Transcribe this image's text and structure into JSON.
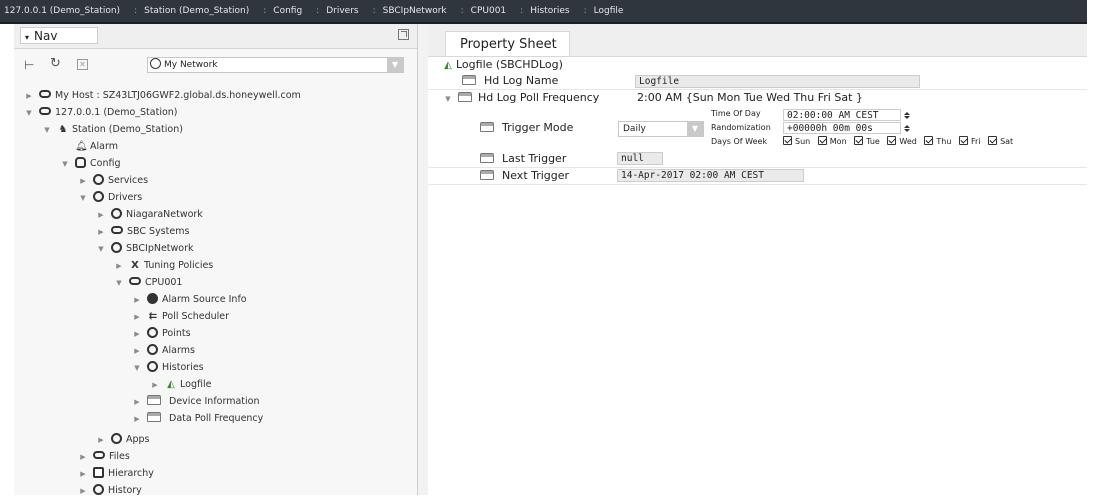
{
  "breadcrumb": [
    "127.0.0.1 (Demo_Station)",
    "Station (Demo_Station)",
    "Config",
    "Drivers",
    "SBCIpNetwork",
    "CPU001",
    "Histories",
    "Logfile"
  ],
  "nav": {
    "title": "Nav",
    "network_dropdown": "My Network",
    "tree": [
      {
        "label": "My Host : SZ43LTJ06GWF2.global.ds.honeywell.com",
        "icon": "host-icon",
        "expanded": false
      },
      {
        "label": "127.0.0.1 (Demo_Station)",
        "icon": "station-connection-icon",
        "expanded": true
      },
      {
        "label": "Station (Demo_Station)",
        "icon": "station-icon",
        "expanded": true
      },
      {
        "label": "Alarm",
        "icon": "bell-icon"
      },
      {
        "label": "Config",
        "icon": "config-icon",
        "expanded": true
      },
      {
        "label": "Services",
        "icon": "services-icon",
        "expanded": false
      },
      {
        "label": "Drivers",
        "icon": "drivers-icon",
        "expanded": true
      },
      {
        "label": "NiagaraNetwork",
        "icon": "network-icon",
        "expanded": false
      },
      {
        "label": "SBC Systems",
        "icon": "network-icon",
        "expanded": false
      },
      {
        "label": "SBCIpNetwork",
        "icon": "network-icon",
        "expanded": true
      },
      {
        "label": "Tuning Policies",
        "icon": "tuning-icon",
        "expanded": false
      },
      {
        "label": "CPU001",
        "icon": "device-icon",
        "expanded": true
      },
      {
        "label": "Alarm Source Info",
        "icon": "alarm-source-icon",
        "expanded": false
      },
      {
        "label": "Poll Scheduler",
        "icon": "poll-scheduler-icon",
        "expanded": false
      },
      {
        "label": "Points",
        "icon": "points-icon",
        "expanded": false
      },
      {
        "label": "Alarms",
        "icon": "alarms-icon",
        "expanded": false
      },
      {
        "label": "Histories",
        "icon": "histories-icon",
        "expanded": true
      },
      {
        "label": "Logfile",
        "icon": "logfile-icon",
        "expanded": false
      },
      {
        "label": "Device Information",
        "icon": "device-info-icon",
        "expanded": false
      },
      {
        "label": "Data Poll Frequency",
        "icon": "poll-frequency-icon",
        "expanded": false
      },
      {
        "label": "Apps",
        "icon": "apps-icon",
        "expanded": false
      },
      {
        "label": "Files",
        "icon": "files-icon",
        "expanded": false
      },
      {
        "label": "Hierarchy",
        "icon": "hierarchy-icon",
        "expanded": false
      },
      {
        "label": "History",
        "icon": "history-icon",
        "expanded": false
      }
    ]
  },
  "sheet": {
    "tab": "Property Sheet",
    "root": "Logfile  (SBCHDLog)",
    "log_name_label": "Hd Log Name",
    "log_name_value": "Logfile",
    "poll_freq_label": "Hd Log Poll Frequency",
    "poll_freq_value": "2:00 AM {Sun Mon Tue Wed Thu Fri Sat }",
    "trigger_mode_label": "Trigger Mode",
    "trigger_mode_value": "Daily",
    "time_of_day_label": "Time Of Day",
    "time_of_day_value": "02:00:00 AM CEST",
    "randomization_label": "Randomization",
    "randomization_value": "+00000h 00m 00s",
    "days_label": "Days Of Week",
    "days": [
      "Sun",
      "Mon",
      "Tue",
      "Wed",
      "Thu",
      "Fri",
      "Sat"
    ],
    "last_trigger_label": "Last Trigger",
    "last_trigger_value": "null",
    "next_trigger_label": "Next Trigger",
    "next_trigger_value": "14-Apr-2017 02:00 AM CEST"
  }
}
